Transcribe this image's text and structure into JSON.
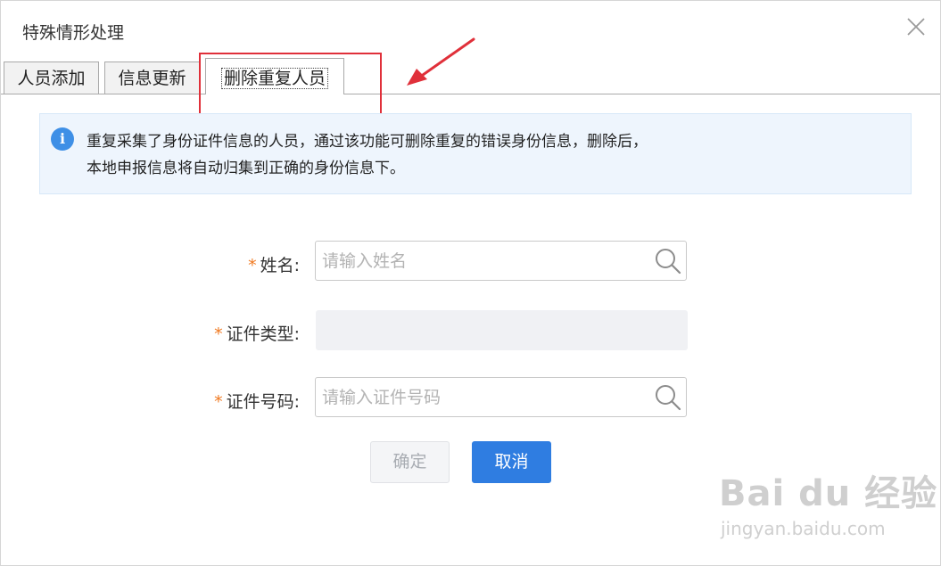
{
  "dialog": {
    "title": "特殊情形处理",
    "close_icon": "close-icon"
  },
  "tabs": [
    {
      "label": "人员添加",
      "active": false
    },
    {
      "label": "信息更新",
      "active": false
    },
    {
      "label": "删除重复人员",
      "active": true
    }
  ],
  "notice": {
    "icon": "info-icon",
    "icon_glyph": "i",
    "line1": "重复采集了身份证件信息的人员，通过该功能可删除重复的错误身份信息，删除后，",
    "line2": "本地申报信息将自动归集到正确的身份信息下。"
  },
  "form": {
    "required_mark": "*",
    "name_label": "姓名:",
    "name_placeholder": "请输入姓名",
    "id_type_label": "证件类型:",
    "id_type_value": "",
    "id_number_label": "证件号码:",
    "id_number_placeholder": "请输入证件号码"
  },
  "buttons": {
    "ok_label": "确定",
    "cancel_label": "取消"
  },
  "watermark": {
    "main": "Bai du 经验",
    "sub": "jingyan.baidu.com"
  },
  "colors": {
    "accent_blue": "#2f7de1",
    "info_blue": "#3e8fe6",
    "required_orange": "#f07a22",
    "annotation_red": "#e0303a",
    "notice_bg": "#eef5fd"
  }
}
